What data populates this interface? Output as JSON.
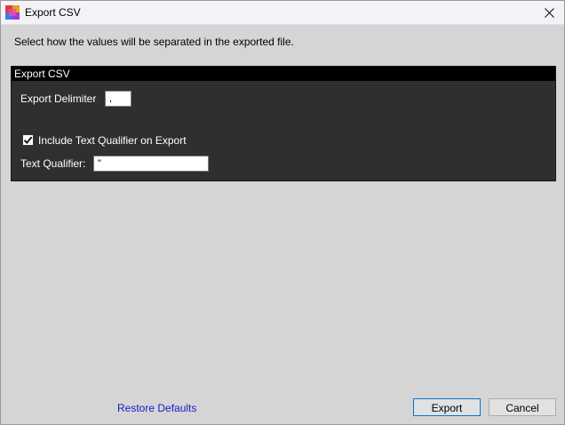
{
  "window": {
    "title": "Export CSV",
    "instructions": "Select how the values will be separated in the exported file."
  },
  "group": {
    "header": "Export CSV",
    "delimiter_label": "Export Delimiter",
    "delimiter_value": ",",
    "include_qualifier_label": "Include Text Qualifier on Export",
    "include_qualifier_checked": true,
    "qualifier_label": "Text Qualifier:",
    "qualifier_value": "\""
  },
  "footer": {
    "restore_label": "Restore Defaults",
    "export_label": "Export",
    "cancel_label": "Cancel"
  },
  "colors": {
    "window_bg": "#d5d5d5",
    "group_bg": "#2f2f2f",
    "group_header_bg": "#000000",
    "link": "#1a1acc",
    "default_button_border": "#0078d7"
  }
}
